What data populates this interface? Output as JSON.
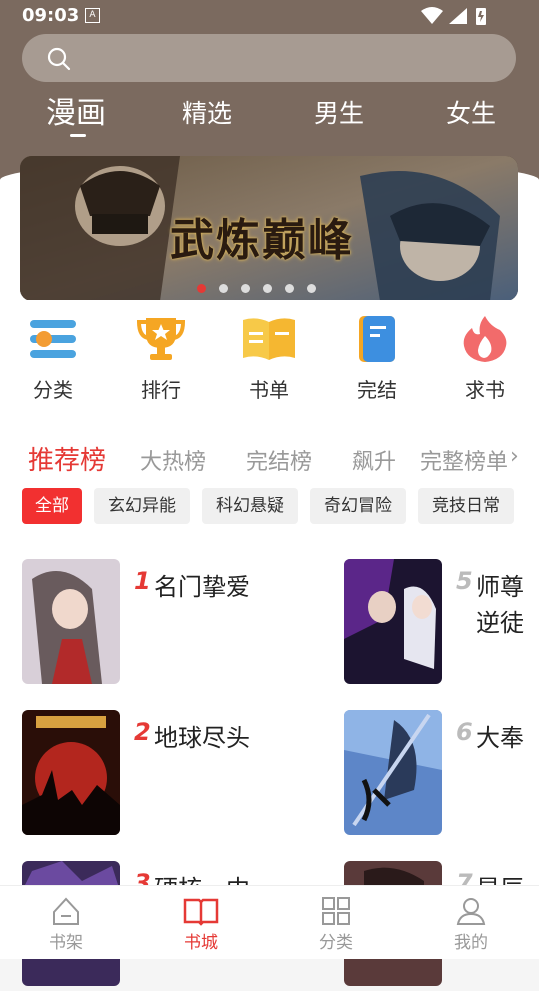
{
  "status": {
    "time": "09:03",
    "a_badge": "A"
  },
  "search": {
    "placeholder": ""
  },
  "top_tabs": [
    {
      "label": "漫画",
      "active": true
    },
    {
      "label": "精选",
      "active": false
    },
    {
      "label": "男生",
      "active": false
    },
    {
      "label": "女生",
      "active": false
    }
  ],
  "banner": {
    "title": "武炼巅峰",
    "page_count": 6,
    "active_page": 1
  },
  "categories": [
    {
      "label": "分类",
      "icon": "list-icon"
    },
    {
      "label": "排行",
      "icon": "trophy-icon"
    },
    {
      "label": "书单",
      "icon": "book-open-icon"
    },
    {
      "label": "完结",
      "icon": "book-icon"
    },
    {
      "label": "求书",
      "icon": "flame-icon"
    }
  ],
  "ranking_tabs": [
    {
      "label": "推荐榜",
      "active": true
    },
    {
      "label": "大热榜",
      "active": false
    },
    {
      "label": "完结榜",
      "active": false
    },
    {
      "label": "飙升",
      "active": false
    },
    {
      "label": "完整榜单",
      "active": false
    }
  ],
  "chips": [
    {
      "label": "全部",
      "active": true
    },
    {
      "label": "玄幻异能",
      "active": false
    },
    {
      "label": "科幻悬疑",
      "active": false
    },
    {
      "label": "奇幻冒险",
      "active": false
    },
    {
      "label": "竞技日常",
      "active": false
    }
  ],
  "books_left": [
    {
      "rank": "1",
      "title": "名门挚爱"
    },
    {
      "rank": "2",
      "title": "地球尽头"
    },
    {
      "rank": "3",
      "title": "硬核一中"
    }
  ],
  "books_right": [
    {
      "rank": "5",
      "title": "师尊",
      "title_line2": "逆徒"
    },
    {
      "rank": "6",
      "title": "大奉"
    },
    {
      "rank": "7",
      "title": "星辰"
    }
  ],
  "bottom_nav": [
    {
      "label": "书架",
      "active": false
    },
    {
      "label": "书城",
      "active": true
    },
    {
      "label": "分类",
      "active": false
    },
    {
      "label": "我的",
      "active": false
    }
  ],
  "colors": {
    "accent": "#e53935",
    "header": "#7b6a5f"
  }
}
